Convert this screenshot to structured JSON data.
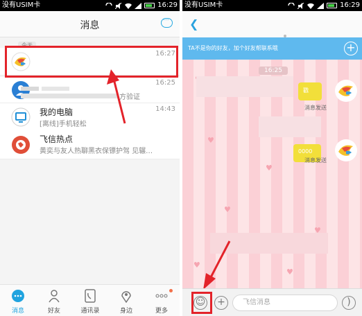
{
  "status_bar": {
    "carrier": "没有USIM卡",
    "time": "16:29"
  },
  "messages_screen": {
    "title": "消息",
    "section_tag": "今天",
    "conversations": [
      {
        "name": "",
        "preview": "",
        "time": "16:27"
      },
      {
        "name": "",
        "preview": "方验证",
        "time": "16:25"
      },
      {
        "name": "我的电脑",
        "preview": "[离线]手机轻松",
        "time": "14:43"
      },
      {
        "name": "飞信热点",
        "preview": "黄奕与友人热聊黑衣保镖护驾 见辗…",
        "time": ""
      }
    ],
    "nav": [
      {
        "label": "消息",
        "icon": "chat-bubble-icon",
        "active": true
      },
      {
        "label": "好友",
        "icon": "person-icon",
        "active": false
      },
      {
        "label": "通讯录",
        "icon": "phone-book-icon",
        "active": false
      },
      {
        "label": "身边",
        "icon": "location-pin-icon",
        "active": false
      },
      {
        "label": "更多",
        "icon": "more-dots-icon",
        "active": false
      }
    ]
  },
  "chat_screen": {
    "banner_text": "TA不是你的好友，加个好友帮联系哦",
    "time_stamp": "16:25",
    "sent_status_1": "消息发送",
    "sent_status_2": "消息发送",
    "input_placeholder": "飞信消息"
  },
  "colors": {
    "accent": "#1fa3df",
    "highlight_red": "#e3232a",
    "banner_blue": "#5fb9ee"
  }
}
